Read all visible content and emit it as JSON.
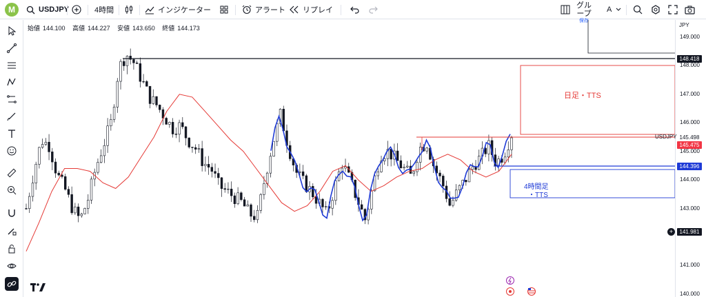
{
  "toolbar": {
    "avatar_letter": "M",
    "symbol": "USDJPY",
    "interval": "4時間",
    "indicators_label": "インジケーター",
    "alert_label": "アラート",
    "replay_label": "リプレイ",
    "group_label": "グループ",
    "save_label": "保存",
    "group_letter": "A"
  },
  "ohlc": {
    "open_label": "始値",
    "open": "144.100",
    "high_label": "高値",
    "high": "144.227",
    "low_label": "安値",
    "low": "143.650",
    "close_label": "終値",
    "close": "144.173"
  },
  "price_axis": {
    "currency": "JPY",
    "ticks": [
      "149.000",
      "148.000",
      "147.000",
      "146.000",
      "145.000",
      "144.000",
      "143.000",
      "141.000",
      "140.000"
    ],
    "tags": {
      "line_148": "148.418",
      "usdjpy_line": "145.498",
      "last_price": "145.475",
      "line_144": "144.396",
      "cursor": "141.981"
    },
    "usdjpy_label": "USDJPY"
  },
  "annotations": {
    "daily_tts": "日足・TTS",
    "h4_tts_line1": "4時間足",
    "h4_tts_line2": "・TTS"
  },
  "colors": {
    "accent_red": "#e53935",
    "accent_blue": "#1e3ad6",
    "last_price_bg": "#f23645",
    "blue_tag_bg": "#1e3ad6",
    "black_tag_bg": "#131722",
    "avatar": "#8bc34a"
  },
  "chart_data": {
    "type": "candlestick",
    "symbol": "USDJPY",
    "interval": "4時間",
    "ylim": [
      139.9,
      149.6
    ],
    "series": [
      {
        "name": "price",
        "approx_path_note": "",
        "values": [
          143.0,
          144.3,
          145.4,
          145.2,
          144.2,
          143.7,
          143.0,
          142.6,
          143.3,
          144.4,
          145.2,
          146.0,
          147.9,
          148.4,
          148.1,
          147.5,
          146.9,
          146.6,
          146.2,
          145.8,
          145.9,
          145.4,
          145.1,
          144.6,
          144.4,
          143.8,
          143.6,
          143.4,
          143.2,
          142.8,
          142.7,
          144.1,
          145.3,
          146.3,
          145.2,
          144.3,
          143.9,
          143.6,
          143.2,
          142.8,
          143.7,
          144.6,
          144.0,
          143.3,
          142.6,
          143.8,
          144.9,
          145.0,
          144.7,
          144.4,
          144.1,
          145.1,
          145.3,
          144.4,
          143.9,
          143.1,
          143.6,
          144.0,
          144.5,
          144.8,
          145.2,
          144.6,
          144.9,
          145.6
        ]
      }
    ],
    "moving_average": [
      141.5,
      142.5,
      143.6,
      144.4,
      144.4,
      144.3,
      143.9,
      143.7,
      144.1,
      144.8,
      145.5,
      146.4,
      147.0,
      146.9,
      146.4,
      145.9,
      145.4,
      145.0,
      144.4,
      143.8,
      143.2,
      142.9,
      143.1,
      143.6,
      144.3,
      144.5,
      144.0,
      143.6,
      143.8,
      144.1,
      144.3,
      144.4,
      144.7,
      144.9,
      144.7,
      144.3,
      144.1,
      144.3,
      144.9
    ]
  }
}
